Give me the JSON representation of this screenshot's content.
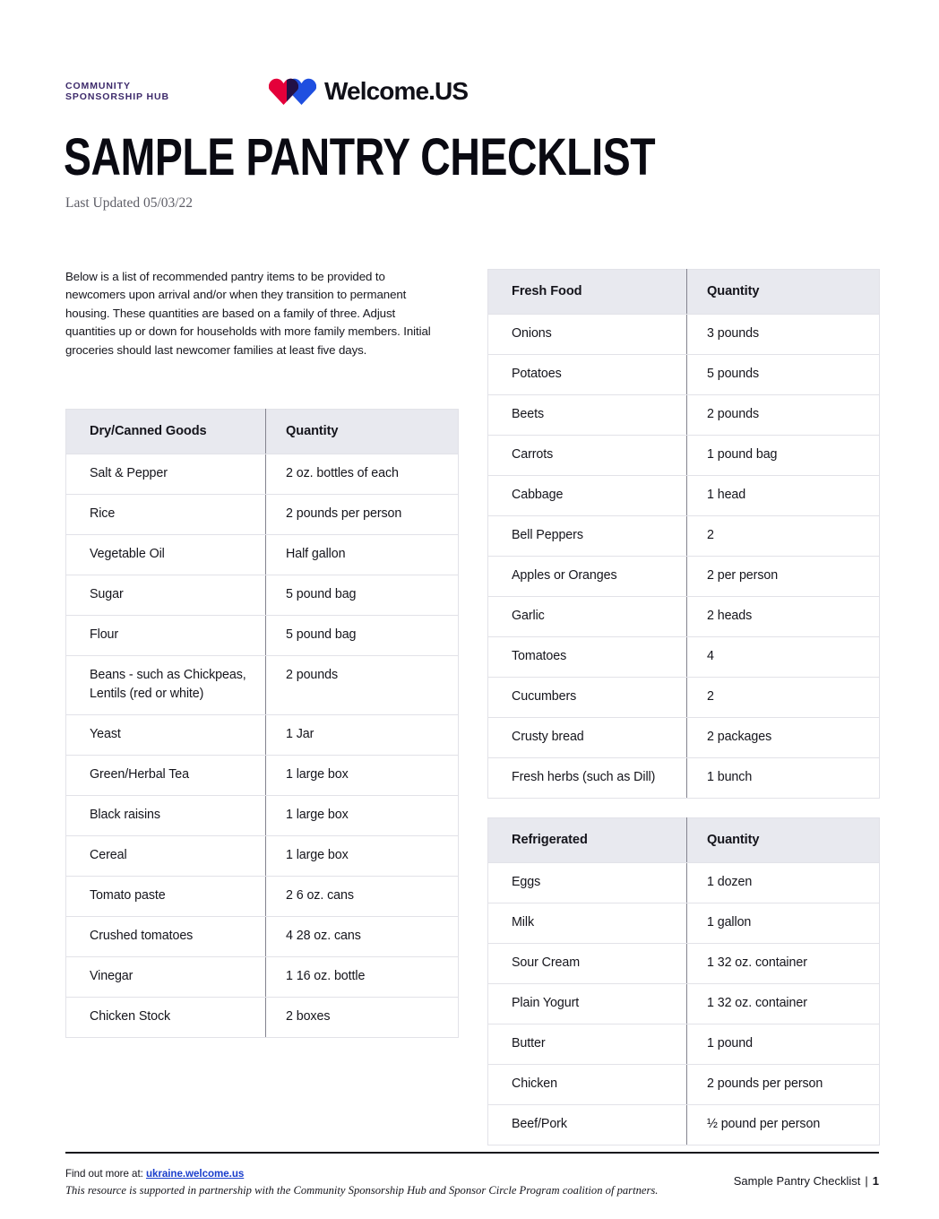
{
  "header": {
    "csh_logo_text": "COMMUNITY SPONSORSHIP HUB",
    "csh_logo_color": "#3d2a6b",
    "welcome_logo_text": "Welcome.US",
    "heart_left_color": "#e4003a",
    "heart_right_color": "#1f4fe0",
    "heart_overlap_color": "#221045"
  },
  "title": "SAMPLE PANTRY CHECKLIST",
  "subtitle": "Last Updated 05/03/22",
  "intro": "Below is a list of recommended pantry items to be provided to newcomers upon arrival and/or when they transition to permanent housing. These quantities are based on a family of three. Adjust quantities up or down for households with more family members. Initial groceries should last newcomer families at least five days.",
  "tables": {
    "dry_canned": {
      "headers": [
        "Dry/Canned Goods",
        "Quantity"
      ],
      "rows": [
        [
          "Salt & Pepper",
          "2 oz. bottles of each"
        ],
        [
          "Rice",
          "2 pounds per person"
        ],
        [
          "Vegetable Oil",
          "Half gallon"
        ],
        [
          "Sugar",
          "5 pound bag"
        ],
        [
          "Flour",
          "5 pound bag"
        ],
        [
          "Beans - such as Chickpeas, Lentils (red or white)",
          "2 pounds"
        ],
        [
          "Yeast",
          "1 Jar"
        ],
        [
          "Green/Herbal Tea",
          "1 large box"
        ],
        [
          "Black raisins",
          "1 large box"
        ],
        [
          "Cereal",
          "1 large box"
        ],
        [
          "Tomato paste",
          "2 6 oz. cans"
        ],
        [
          "Crushed tomatoes",
          "4 28 oz. cans"
        ],
        [
          "Vinegar",
          "1 16 oz. bottle"
        ],
        [
          "Chicken Stock",
          "2 boxes"
        ]
      ]
    },
    "fresh_food": {
      "headers": [
        "Fresh Food",
        "Quantity"
      ],
      "rows": [
        [
          "Onions",
          "3 pounds"
        ],
        [
          "Potatoes",
          "5 pounds"
        ],
        [
          "Beets",
          "2 pounds"
        ],
        [
          "Carrots",
          "1 pound bag"
        ],
        [
          "Cabbage",
          "1 head"
        ],
        [
          "Bell Peppers",
          "2"
        ],
        [
          "Apples or Oranges",
          "2 per person"
        ],
        [
          "Garlic",
          "2 heads"
        ],
        [
          "Tomatoes",
          "4"
        ],
        [
          "Cucumbers",
          "2"
        ],
        [
          "Crusty bread",
          "2 packages"
        ],
        [
          "Fresh herbs (such as Dill)",
          "1 bunch"
        ]
      ]
    },
    "refrigerated": {
      "headers": [
        "Refrigerated",
        "Quantity"
      ],
      "rows": [
        [
          "Eggs",
          "1 dozen"
        ],
        [
          "Milk",
          "1 gallon"
        ],
        [
          "Sour Cream",
          "1 32 oz. container"
        ],
        [
          "Plain Yogurt",
          "1 32 oz. container"
        ],
        [
          "Butter",
          "1 pound"
        ],
        [
          "Chicken",
          "2 pounds per person"
        ],
        [
          "Beef/Pork",
          "½ pound per person"
        ]
      ]
    }
  },
  "footer": {
    "find_out_prefix": "Find out more at: ",
    "link_text": "ukraine.welcome.us",
    "link_color": "#1a3ecc",
    "disclaimer": "This resource is supported in partnership with the Community Sponsorship Hub and Sponsor Circle Program coalition of partners.",
    "doc_name": "Sample Pantry Checklist",
    "separator": "|",
    "page_number": "1"
  }
}
